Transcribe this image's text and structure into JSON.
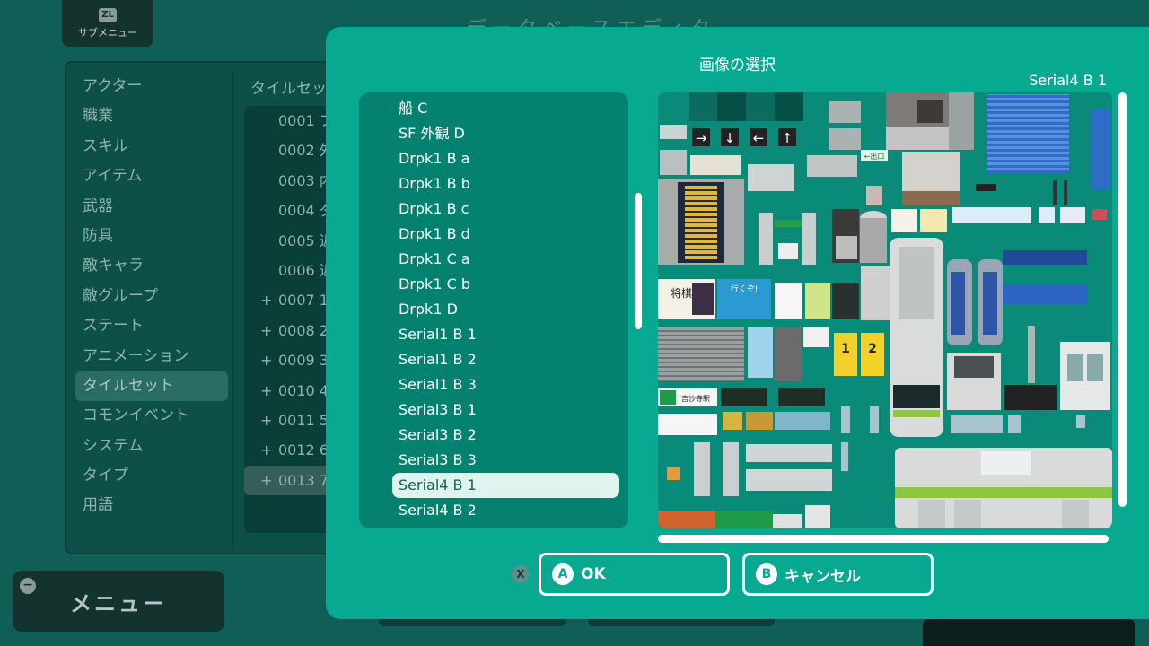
{
  "background": {
    "submenu": {
      "badge": "ZL",
      "label": "サブメニュー"
    },
    "title_partial": "データベースエディタ",
    "categories": [
      "アクター",
      "職業",
      "スキル",
      "アイテム",
      "武器",
      "防具",
      "敵キャラ",
      "敵グループ",
      "ステート",
      "アニメーション",
      "タイルセット",
      "コモンイベント",
      "システム",
      "タイプ",
      "用語"
    ],
    "active_category_index": 10,
    "tileset_header": "タイルセット",
    "tilesets": [
      {
        "label": "0001 フ",
        "expandable": false
      },
      {
        "label": "0002 外",
        "expandable": false
      },
      {
        "label": "0003 内",
        "expandable": false
      },
      {
        "label": "0004 ダ",
        "expandable": false
      },
      {
        "label": "0005 近",
        "expandable": false
      },
      {
        "label": "0006 近",
        "expandable": false
      },
      {
        "label": "0007 1",
        "expandable": true
      },
      {
        "label": "0008 2",
        "expandable": true
      },
      {
        "label": "0009 3",
        "expandable": true
      },
      {
        "label": "0010 4",
        "expandable": true
      },
      {
        "label": "0011 5",
        "expandable": true
      },
      {
        "label": "0012 6",
        "expandable": true
      },
      {
        "label": "0013 7",
        "expandable": true
      }
    ],
    "menu": {
      "badge": "−",
      "label": "メニュー"
    }
  },
  "modal": {
    "title": "画像の選択",
    "preview_label": "Serial4 B 1",
    "files": [
      "船 C",
      "SF 外観 D",
      "Drpk1 B a",
      "Drpk1 B b",
      "Drpk1 B c",
      "Drpk1 B d",
      "Drpk1 C a",
      "Drpk1 C b",
      "Drpk1 D",
      "Serial1 B 1",
      "Serial1 B 2",
      "Serial1 B 3",
      "Serial3 B 1",
      "Serial3 B 2",
      "Serial3 B 3",
      "Serial4 B 1",
      "Serial4 B 2"
    ],
    "selected_index": 15,
    "x_badge": "X",
    "ok": {
      "badge": "A",
      "label": "OK"
    },
    "cancel": {
      "badge": "B",
      "label": "キャンセル"
    }
  },
  "preview_tiles": {
    "station_sign_1": "将棋",
    "station_sign_2": "行くぞ!",
    "exit_1": "1",
    "exit_2": "2",
    "station_name": "吉沙寺駅"
  },
  "colors": {
    "modal_bg": "#07a990",
    "list_bg": "#05826f",
    "selected_bg": "#dff3ef",
    "page_bg": "#0f5f56"
  }
}
